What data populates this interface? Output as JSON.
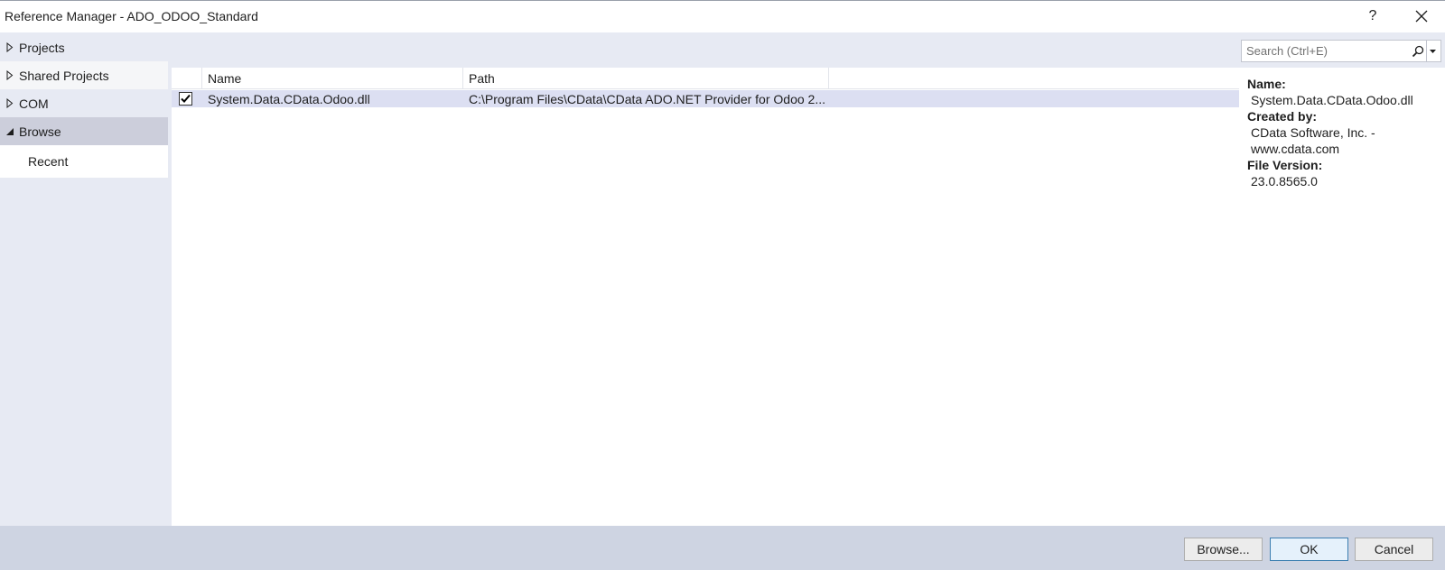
{
  "window": {
    "title": "Reference Manager - ADO_ODOO_Standard",
    "help_label": "?",
    "close_label": "✕"
  },
  "nav": {
    "items": [
      {
        "label": "Projects",
        "expanded": false
      },
      {
        "label": "Shared Projects",
        "expanded": false
      },
      {
        "label": "COM",
        "expanded": false
      },
      {
        "label": "Browse",
        "expanded": true,
        "selected": true
      },
      {
        "label": "Recent"
      }
    ]
  },
  "search": {
    "placeholder": "Search (Ctrl+E)",
    "value": ""
  },
  "list": {
    "columns": [
      "Name",
      "Path"
    ],
    "rows": [
      {
        "checked": true,
        "name": "System.Data.CData.Odoo.dll",
        "path": "C:\\Program Files\\CData\\CData ADO.NET Provider for Odoo 2..."
      }
    ]
  },
  "details": {
    "name_label": "Name:",
    "name_value": "System.Data.CData.Odoo.dll",
    "created_by_label": "Created by:",
    "created_by_value_line1": "CData Software, Inc. -",
    "created_by_value_line2": "www.cdata.com",
    "file_version_label": "File Version:",
    "file_version_value": "23.0.8565.0"
  },
  "footer": {
    "browse_label": "Browse...",
    "ok_label": "OK",
    "cancel_label": "Cancel"
  },
  "colors": {
    "background": "#e7eaf3",
    "selected_nav": "#cccedb",
    "selected_row": "#dcdff2",
    "footer": "#ced4e2",
    "ok_border": "#3c7fb1"
  }
}
